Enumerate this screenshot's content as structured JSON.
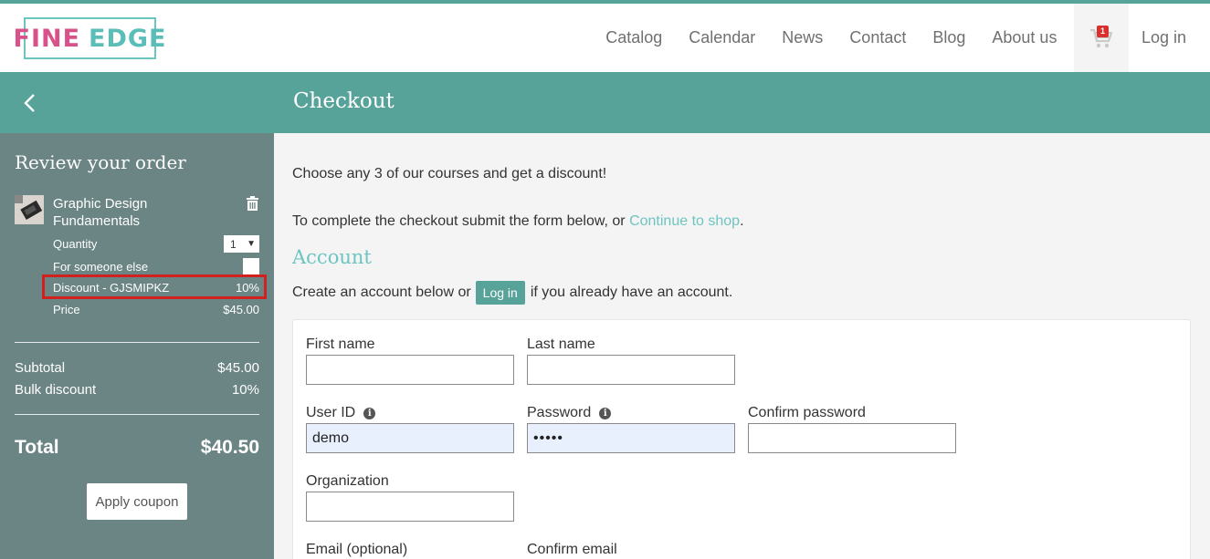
{
  "header": {
    "logo_fine": "FINE",
    "logo_edge": "EDGE",
    "nav": [
      "Catalog",
      "Calendar",
      "News",
      "Contact",
      "Blog",
      "About us"
    ],
    "cart_count": "1",
    "login": "Log in"
  },
  "band": {
    "title": "Checkout"
  },
  "sidebar": {
    "heading": "Review your order",
    "item": {
      "title": "Graphic Design Fundamentals",
      "quantity_label": "Quantity",
      "quantity_value": "1",
      "someone_label": "For someone else",
      "discount_label": "Discount - GJSMIPKZ",
      "discount_value": "10%",
      "price_label": "Price",
      "price_value": "$45.00"
    },
    "subtotal_label": "Subtotal",
    "subtotal_value": "$45.00",
    "bulk_label": "Bulk discount",
    "bulk_value": "10%",
    "total_label": "Total",
    "total_value": "$40.50",
    "coupon_button": "Apply coupon"
  },
  "main": {
    "promo": "Choose any 3 of our courses and get a discount!",
    "instructions_prefix": "To complete the checkout submit the form below, or ",
    "continue_link": "Continue to shop",
    "instructions_suffix": ".",
    "account_heading": "Account",
    "create_prefix": "Create an account below or",
    "login_button": "Log in",
    "create_suffix": "if you already have an account.",
    "form": {
      "first_name_label": "First name",
      "first_name_value": "",
      "last_name_label": "Last name",
      "last_name_value": "",
      "user_id_label": "User ID",
      "user_id_value": "demo",
      "password_label": "Password",
      "password_value": "•••••",
      "confirm_password_label": "Confirm password",
      "confirm_password_value": "",
      "organization_label": "Organization",
      "organization_value": "",
      "email_label": "Email (optional)",
      "confirm_email_label": "Confirm email"
    }
  },
  "colors": {
    "teal": "#57a39a",
    "light_teal": "#6dc5c0",
    "sidebar": "#6b8584",
    "highlight_box": "#d0201f",
    "logo_pink": "#d8518a"
  },
  "icons": [
    "back-arrow-icon",
    "cart-icon",
    "trash-icon",
    "info-icon"
  ]
}
